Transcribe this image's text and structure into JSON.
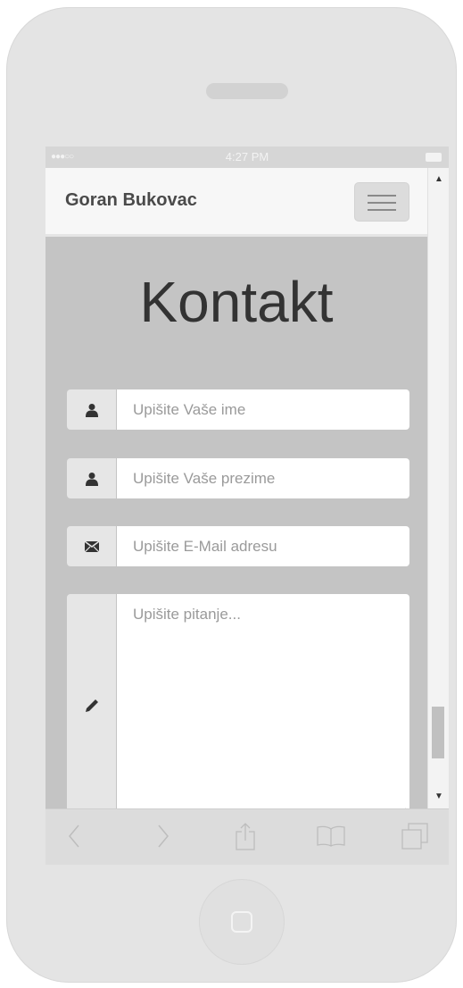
{
  "status_bar": {
    "time": "4:27 PM",
    "signal": "●●●○○"
  },
  "header": {
    "brand": "Goran Bukovac"
  },
  "page": {
    "title": "Kontakt"
  },
  "form": {
    "first_name": {
      "placeholder": "Upišite Vaše ime",
      "icon": "user-icon"
    },
    "last_name": {
      "placeholder": "Upišite Vaše prezime",
      "icon": "user-icon"
    },
    "email": {
      "placeholder": "Upišite E-Mail adresu",
      "icon": "envelope-icon"
    },
    "question": {
      "placeholder": "Upišite pitanje...",
      "icon": "pencil-icon"
    }
  },
  "scrollbar": {
    "up_arrow": "▲",
    "down_arrow": "▼"
  },
  "toolbar": {
    "items": [
      "back-icon",
      "forward-icon",
      "share-icon",
      "bookmarks-icon",
      "tabs-icon"
    ]
  },
  "colors": {
    "screen_background": "#c4c4c4",
    "navbar_background": "#f7f7f7",
    "addon_background": "#e6e6e6",
    "title_text": "#333333"
  }
}
